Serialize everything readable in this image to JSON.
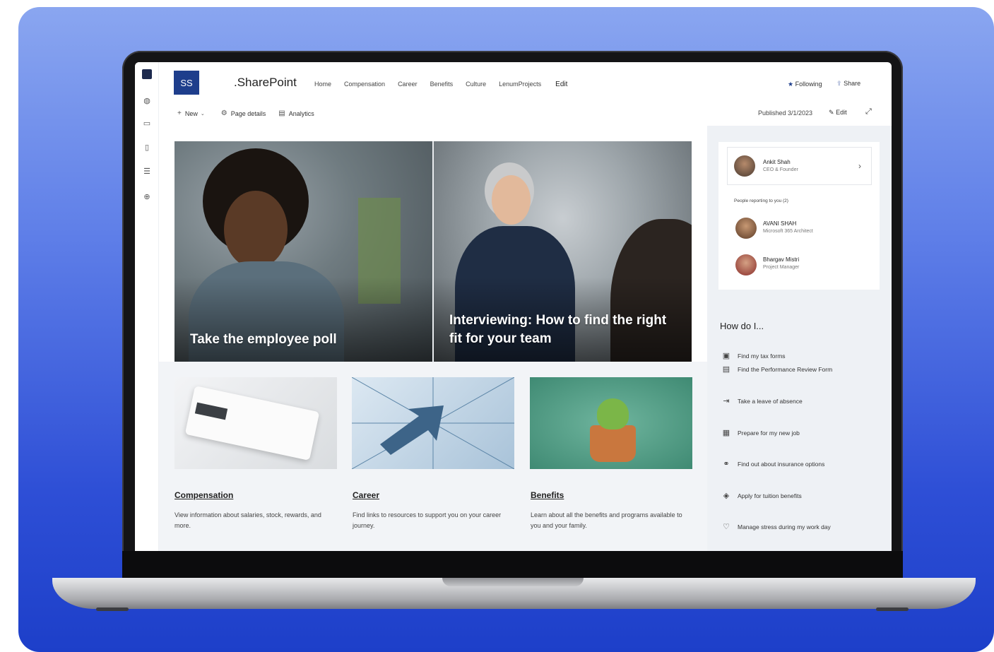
{
  "site": {
    "logo": "SS",
    "name": ".SharePoint",
    "nav": [
      "Home",
      "Compensation",
      "Career",
      "Benefits",
      "Culture",
      "LenumProjects"
    ],
    "nav_edit": "Edit",
    "following": "Following",
    "share": "Share"
  },
  "commandbar": {
    "new": "New",
    "page_details": "Page details",
    "analytics": "Analytics",
    "published": "Published 3/1/2023",
    "edit": "Edit"
  },
  "hero": [
    {
      "title": "Take the employee poll"
    },
    {
      "title": "Interviewing: How to find the right fit for your team"
    }
  ],
  "tiles": [
    {
      "title": "Compensation",
      "desc": "View information about salaries, stock, rewards, and more."
    },
    {
      "title": "Career",
      "desc": "Find links to resources to support you on your career journey."
    },
    {
      "title": "Benefits",
      "desc": "Learn about all the benefits and programs available to you and your family."
    }
  ],
  "org": {
    "manager": {
      "name": "Ankit Shah",
      "role": "CEO & Founder"
    },
    "reporting_label": "People reporting to you (2)",
    "reports": [
      {
        "name": "AVANI SHAH",
        "role": "Microsoft 365 Architect"
      },
      {
        "name": "Bhargav Mistri",
        "role": "Project Manager"
      }
    ]
  },
  "howdo": {
    "title": "How do I...",
    "items": [
      "Find my tax forms",
      "Find the Performance Review Form",
      "Take a leave of absence",
      "Prepare for my new job",
      "Find out about insurance options",
      "Apply for tuition benefits",
      "Manage stress during my work day"
    ]
  },
  "colors": {
    "background_top": "#8aa6f0",
    "background_bottom": "#1d3fc9",
    "logo_tile": "#1e3e8c",
    "panel": "#eef1f5"
  }
}
